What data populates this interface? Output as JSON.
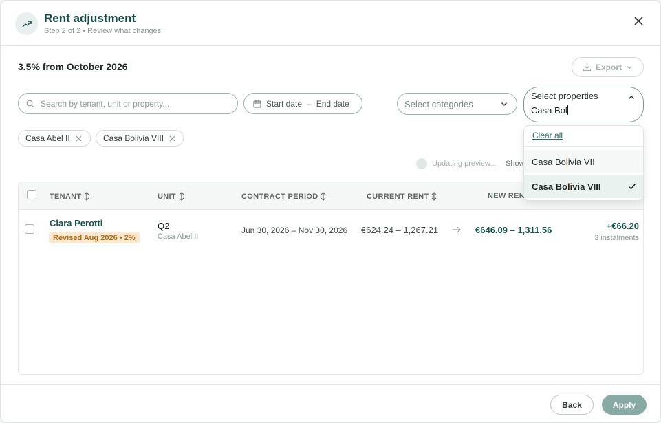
{
  "header": {
    "title": "Rent adjustment",
    "subtitle": "Step 2 of 2 • Review what changes",
    "icon": "trending-up-icon",
    "close_icon": "close-icon"
  },
  "summary": {
    "title": "3.5% from October 2026",
    "export_label": "Export"
  },
  "filters": {
    "search_placeholder": "Search by tenant, unit or property...",
    "start_date": "Start date",
    "date_separator": "–",
    "end_date": "End date",
    "categories_placeholder": "Select categories",
    "properties_placeholder": "Select properties",
    "properties_query": "Casa Bol"
  },
  "chips": [
    {
      "label": "Casa Abel II"
    },
    {
      "label": "Casa Bolivia VIII"
    }
  ],
  "status": {
    "updating": "Updating preview...",
    "show": "Show"
  },
  "dropdown": {
    "clear_all": "Clear all",
    "options": [
      {
        "prefix": "Casa Bo",
        "match": "l",
        "suffix": "ivia VII",
        "selected": false
      },
      {
        "prefix": "Casa Bo",
        "match": "l",
        "suffix": "ivia VIII",
        "selected": true
      }
    ]
  },
  "table": {
    "columns": [
      "TENANT",
      "UNIT",
      "CONTRACT PERIOD",
      "CURRENT RENT",
      "NEW RENT"
    ],
    "rows": [
      {
        "tenant": "Clara Perotti",
        "badge": "Revised Aug 2026 • 2%",
        "unit": "Q2",
        "property": "Casa Abel II",
        "period": "Jun 30, 2026 – Nov 30, 2026",
        "current_rent": "€624.24 – 1,267.21",
        "new_rent": "€646.09 – 1,311.56",
        "difference": "+€66.20",
        "instalments": "3 instalments"
      }
    ]
  },
  "footer": {
    "back_label": "Back",
    "apply_label": "Apply"
  },
  "colors": {
    "brand": "#144a45",
    "accent": "#17524b",
    "apply_disabled": "#87aaa5",
    "badge_bg": "#fbe8cf",
    "badge_text": "#b06a12",
    "highlight": "#fbecd6"
  }
}
